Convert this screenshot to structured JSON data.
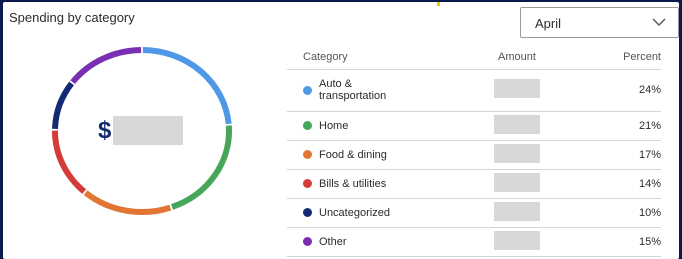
{
  "card": {
    "title": "Spending by category",
    "month_select": {
      "value": "April"
    }
  },
  "donut": {
    "currency_symbol": "$",
    "total_value_masked": true
  },
  "table": {
    "headers": {
      "category": "Category",
      "amount": "Amount",
      "percent": "Percent"
    },
    "rows": [
      {
        "label": "Auto & transportation",
        "color": "#4f98e6",
        "percent": "24%",
        "amount_masked": true
      },
      {
        "label": "Home",
        "color": "#46a65a",
        "percent": "21%",
        "amount_masked": true
      },
      {
        "label": "Food & dining",
        "color": "#e07632",
        "percent": "17%",
        "amount_masked": true
      },
      {
        "label": "Bills & utilities",
        "color": "#d33c38",
        "percent": "14%",
        "amount_masked": true
      },
      {
        "label": "Uncategorized",
        "color": "#142a74",
        "percent": "10%",
        "amount_masked": true
      },
      {
        "label": "Other",
        "color": "#7a2fb3",
        "percent": "15%",
        "amount_masked": true
      }
    ]
  },
  "colors": {
    "page_background": "#0b1a4a",
    "card_background": "#ffffff",
    "mask": "#d8d8d8",
    "accent": "#f2c40f"
  }
}
